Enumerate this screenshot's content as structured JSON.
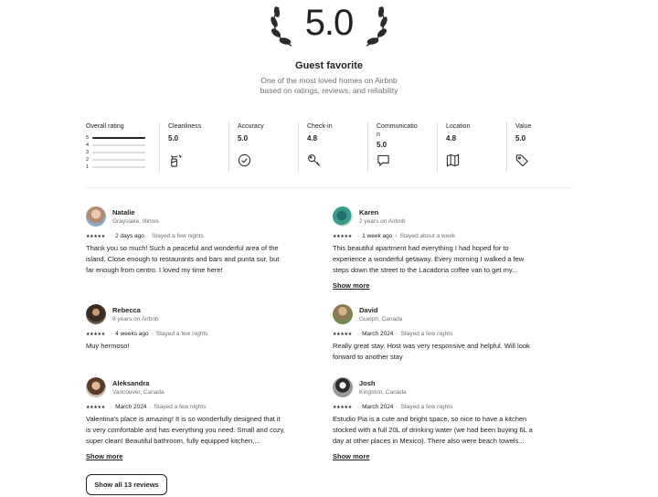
{
  "summary": {
    "rating": "5.0",
    "title": "Guest favorite",
    "subtitle_line1": "One of the most loved homes on Airbnb",
    "subtitle_line2": "based on ratings, reviews, and reliability"
  },
  "overall": {
    "label": "Overall rating",
    "distribution": [
      {
        "stars": "5",
        "fraction": 1.0
      },
      {
        "stars": "4",
        "fraction": 0.0
      },
      {
        "stars": "3",
        "fraction": 0.0
      },
      {
        "stars": "2",
        "fraction": 0.0
      },
      {
        "stars": "1",
        "fraction": 0.0
      }
    ]
  },
  "categories": [
    {
      "label": "Cleanliness",
      "value": "5.0",
      "icon": "spray-bottle-icon"
    },
    {
      "label": "Accuracy",
      "value": "5.0",
      "icon": "check-circle-icon"
    },
    {
      "label": "Check-in",
      "value": "4.8",
      "icon": "key-icon"
    },
    {
      "label": "Communicatio\nn",
      "value": "5.0",
      "icon": "chat-bubble-icon"
    },
    {
      "label": "Location",
      "value": "4.8",
      "icon": "map-icon"
    },
    {
      "label": "Value",
      "value": "5.0",
      "icon": "tag-icon"
    }
  ],
  "reviews": [
    {
      "name": "Natalie",
      "meta": "Grayslake, Illinois",
      "stars": "★★★★★",
      "date": "2 days ago",
      "stay": "Stayed a few nights",
      "text": "Thank you so much! Such a peaceful and wonderful area of the island. Close enough to restaurants and bars and punta sur, but far enough from centro. I loved my time here!",
      "show_more": ""
    },
    {
      "name": "Karen",
      "meta": "2 years on Airbnb",
      "stars": "★★★★★",
      "date": "1 week ago",
      "stay": "Stayed about a week",
      "text": "This beautiful apartment had everything I had hoped for to experience a wonderful getaway. Every morning I walked a few steps down the street to the Lacadona coffee van to get my...",
      "show_more": "Show more"
    },
    {
      "name": "Rebecca",
      "meta": "8 years on Airbnb",
      "stars": "★★★★★",
      "date": "4 weeks ago",
      "stay": "Stayed a few nights",
      "text": "Muy hermoso!",
      "show_more": ""
    },
    {
      "name": "David",
      "meta": "Guelph, Canada",
      "stars": "★★★★★",
      "date": "March 2024",
      "stay": "Stayed a few nights",
      "text": "Really great stay. Host was very responsive and helpful. Will look forward to another stay",
      "show_more": ""
    },
    {
      "name": "Aleksandra",
      "meta": "Vancouver, Canada",
      "stars": "★★★★★",
      "date": "March 2024",
      "stay": "Stayed a few nights",
      "text": "Valentina's place is amazing! It is so wonderfully designed that it is very comfortable and has everything you need. Small and cozy, super clean! Beautiful bathroom, fully equipped kitchen,...",
      "show_more": "Show more"
    },
    {
      "name": "Josh",
      "meta": "Kingston, Canada",
      "stars": "★★★★★",
      "date": "March 2024",
      "stay": "Stayed a few nights",
      "text": "Estudio Pia is a cute and bright space, so nice to have a kitchen stocked with a full 20L of drinking water (we had been buying 6L a day at other places in Mexico). There also were beach towels...",
      "show_more": "Show more"
    }
  ],
  "show_all_label": "Show all 13 reviews"
}
